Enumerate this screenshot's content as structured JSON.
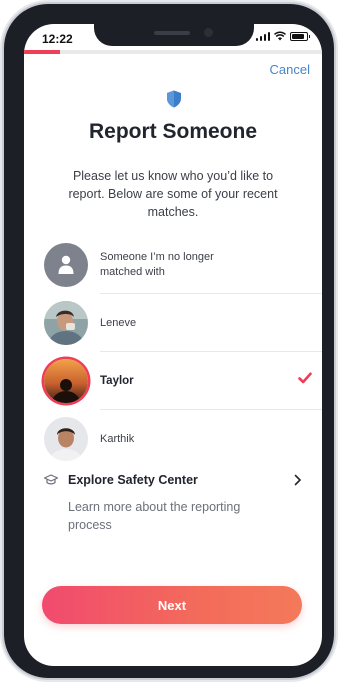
{
  "status": {
    "time": "12:22",
    "battery_level": 0.85
  },
  "progress": {
    "fraction": 0.12,
    "color": "#ef3e56"
  },
  "header": {
    "cancel_label": "Cancel",
    "icon": "shield-icon"
  },
  "page": {
    "title": "Report Someone",
    "subtitle": "Please let us know who you’d like to report. Below are some of your recent matches."
  },
  "matches": [
    {
      "name": "Someone I’m no longer matched with",
      "avatar": "generic-person-icon",
      "selected": false
    },
    {
      "name": "Leneve",
      "avatar": "photo",
      "selected": false
    },
    {
      "name": "Taylor",
      "avatar": "photo",
      "selected": true
    },
    {
      "name": "Karthik",
      "avatar": "photo",
      "selected": false
    }
  ],
  "safety": {
    "icon": "graduation-cap-icon",
    "title": "Explore Safety Center",
    "description": "Learn more about the reporting process"
  },
  "footer": {
    "next_label": "Next"
  },
  "colors": {
    "accent": "#ef3e56",
    "link": "#4a84c9",
    "shield": "#3b7ec9"
  }
}
